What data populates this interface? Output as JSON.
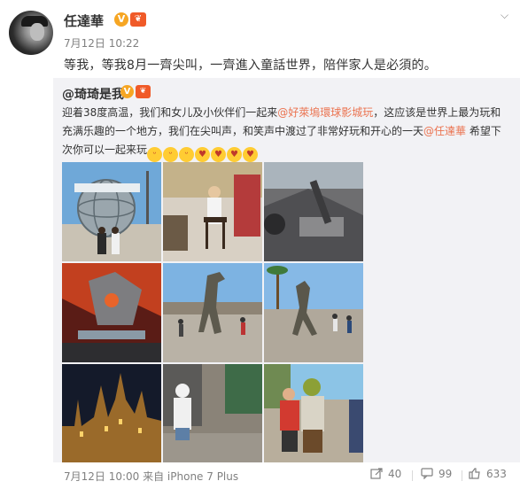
{
  "author": {
    "name": "任達華",
    "verified_mark": "V",
    "crown_mark": "❦"
  },
  "post": {
    "time": "7月12日 10:22",
    "text": "等我，等我8月一齊尖叫，一齊進入童話世界，陪伴家人是必須的。"
  },
  "repost": {
    "user": "@琦琦是我",
    "verified_mark": "V",
    "crown_mark": "❦",
    "text_part1": "迎着38度高温，我们和女儿及小伙伴们一起来",
    "link1": "@好萊塢環球影城玩",
    "text_part2": "，这应该是世界上最为玩和充满乐趣的一个地方，我们在尖叫声，和笑声中渡过了非常好玩和开心的一天",
    "link2": "@任達華",
    "text_part3": " 希望下次你可以一起来玩",
    "emojis": [
      "emoji-tongue",
      "emoji-tongue",
      "emoji-tongue",
      "emoji-wink",
      "emoji-wink",
      "emoji-wink",
      "emoji-wink"
    ],
    "photos": [
      {
        "name": "universal-globe"
      },
      {
        "name": "director-chair"
      },
      {
        "name": "ride-set"
      },
      {
        "name": "transformers"
      },
      {
        "name": "raptor-1"
      },
      {
        "name": "raptor-2"
      },
      {
        "name": "hogwarts-castle"
      },
      {
        "name": "girl-street"
      },
      {
        "name": "shrek-photo"
      }
    ],
    "footer": {
      "time": "7月12日 10:00 来自 iPhone 7 Plus",
      "share_count": "40",
      "comment_count": "99",
      "like_count": "633"
    }
  },
  "colors": {
    "link": "#eb7350",
    "quote_bg": "#f2f2f5",
    "meta": "#808080"
  }
}
